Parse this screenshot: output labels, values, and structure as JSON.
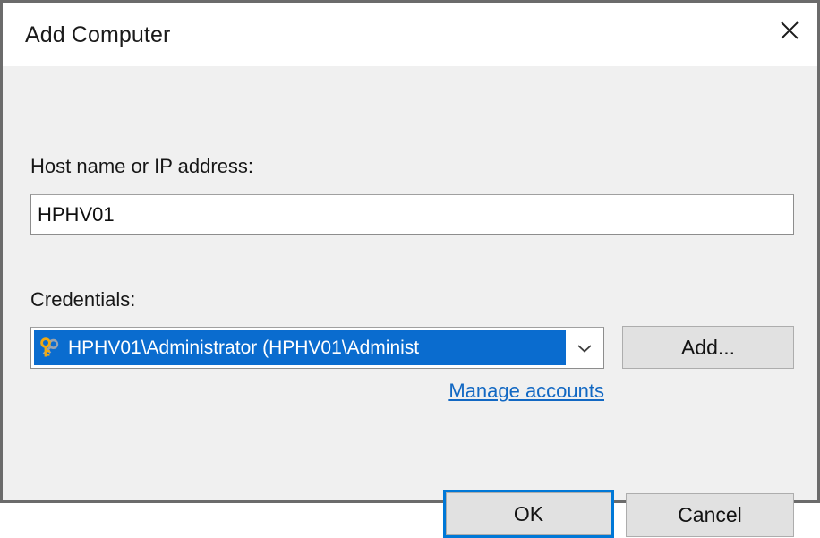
{
  "window": {
    "title": "Add Computer",
    "close_icon": "close-icon"
  },
  "form": {
    "host_label": "Host name or IP address:",
    "host_value": "HPHV01",
    "host_placeholder": "",
    "credentials_label": "Credentials:",
    "credentials_selected": "HPHV01\\Administrator (HPHV01\\Administ",
    "credentials_icon": "key-icon",
    "credentials_dropdown_icon": "chevron-down-icon",
    "add_label": "Add...",
    "manage_accounts_label": "Manage accounts"
  },
  "footer": {
    "ok_label": "OK",
    "cancel_label": "Cancel"
  },
  "colors": {
    "accent": "#0078d7",
    "selection": "#0a6ccf",
    "link": "#1268c3",
    "dialog_bg": "#f0f0f0",
    "titlebar_bg": "#ffffff",
    "button_bg": "#e1e1e1",
    "key_gold": "#f0a913"
  }
}
